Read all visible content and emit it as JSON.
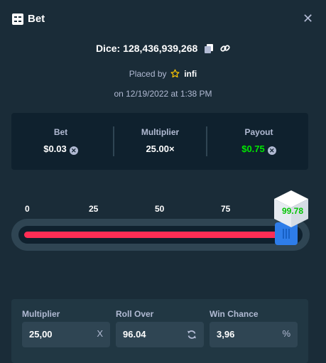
{
  "header": {
    "title": "Bet",
    "close_label": "✕"
  },
  "bet_info": {
    "dice_label": "Dice:",
    "dice_id": "128,436,939,268",
    "placed_by_label": "Placed by",
    "user": "infi",
    "date": "on 12/19/2022 at 1:38 PM"
  },
  "stats": {
    "bet": {
      "label": "Bet",
      "value": "$0.03"
    },
    "multiplier": {
      "label": "Multiplier",
      "value": "25.00×"
    },
    "payout": {
      "label": "Payout",
      "value": "$0.75"
    }
  },
  "slider": {
    "scale_labels": [
      "0",
      "25",
      "50",
      "75"
    ],
    "roll_over_value": 96.04,
    "result": "99.78"
  },
  "controls": {
    "multiplier": {
      "label": "Multiplier",
      "value": "25,00",
      "suffix": "X"
    },
    "roll_over": {
      "label": "Roll Over",
      "value": "96.04"
    },
    "win_chance": {
      "label": "Win Chance",
      "value": "3,96",
      "suffix": "%"
    }
  },
  "colors": {
    "background": "#1a2c38",
    "panel": "#0f212e",
    "accent_green": "#00e701",
    "accent_red": "#ff2d55",
    "handle_blue": "#2e7de9",
    "muted_text": "#b1bad3"
  },
  "icons": [
    "bet-icon",
    "close-icon",
    "copy-icon",
    "link-icon",
    "star-icon",
    "currency-icon",
    "refresh-icon",
    "dice-cube-icon"
  ]
}
